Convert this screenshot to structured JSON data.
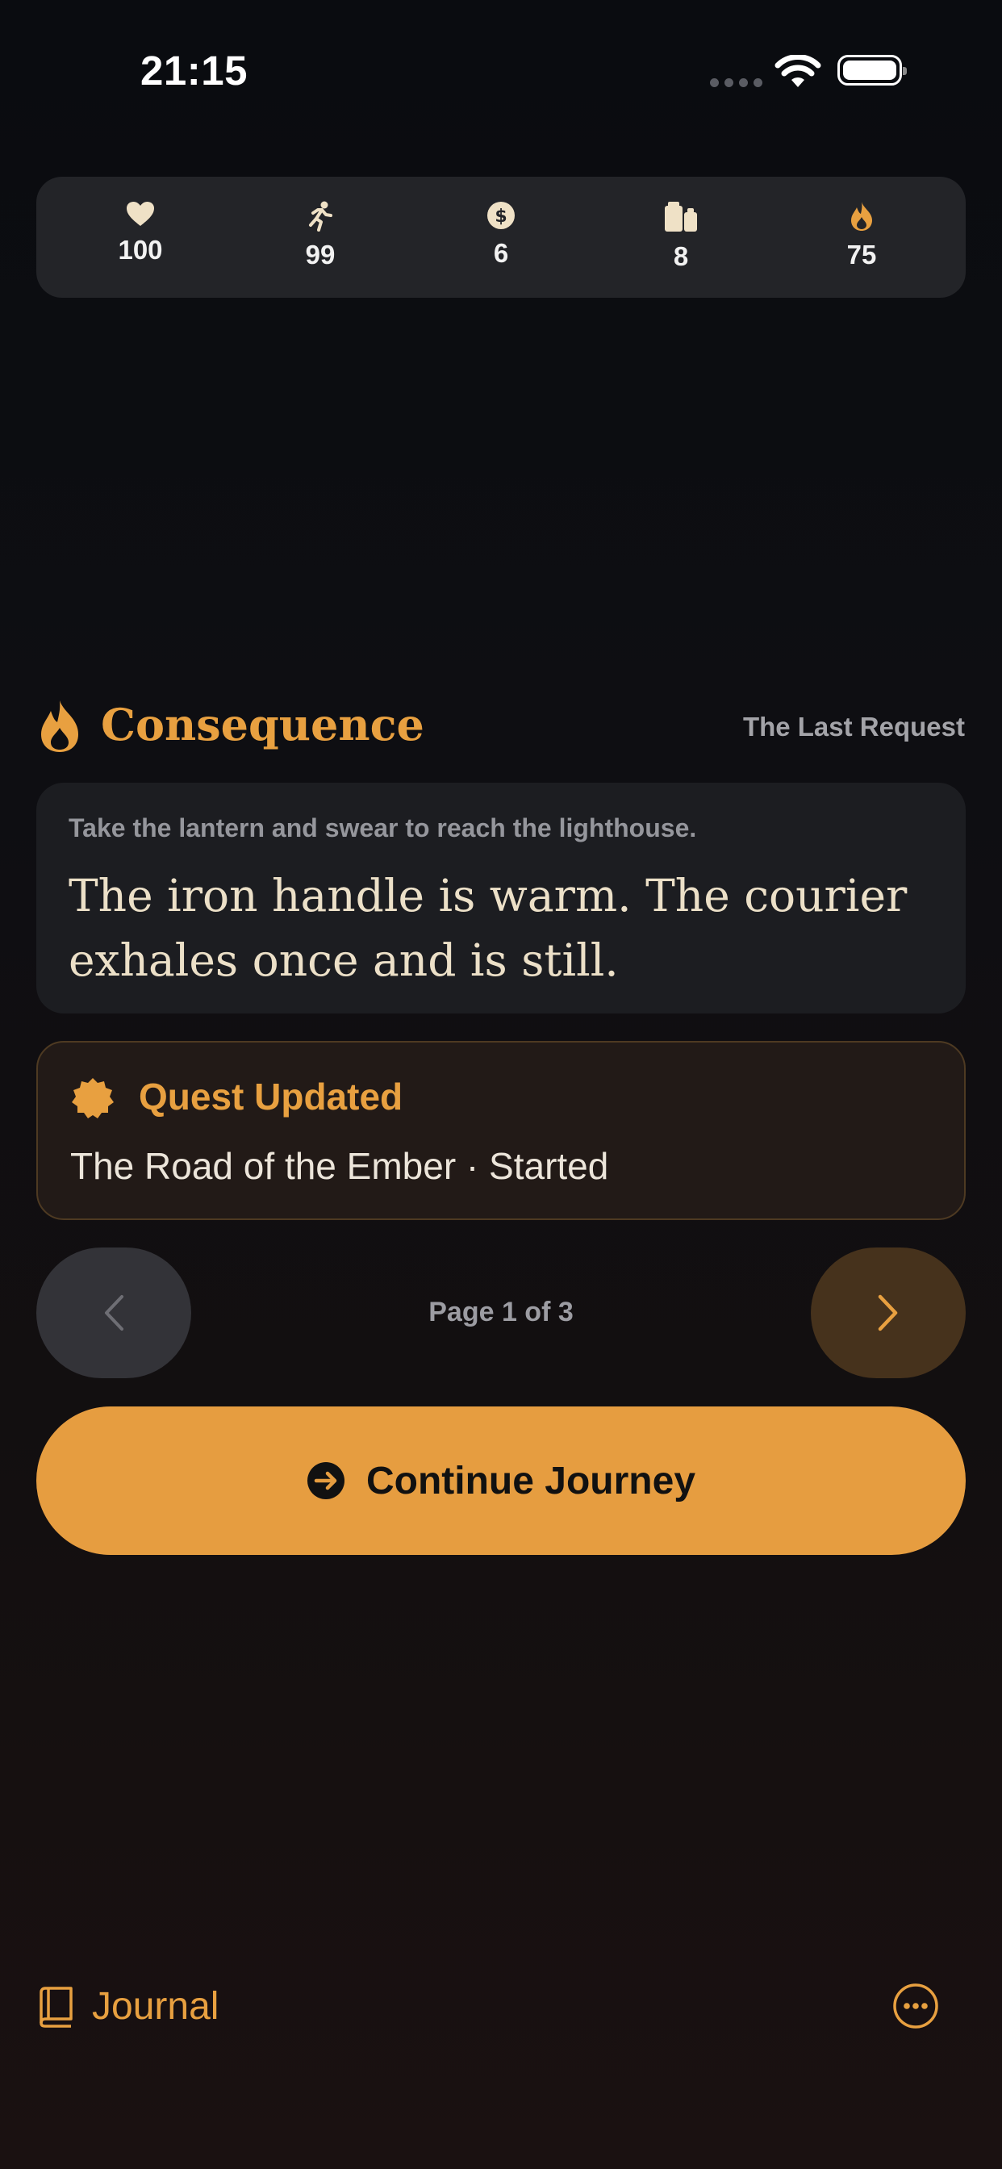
{
  "status_bar": {
    "time": "21:15"
  },
  "stats": [
    {
      "icon": "heart-icon",
      "value": "100"
    },
    {
      "icon": "running-figure-icon",
      "value": "99"
    },
    {
      "icon": "coin-icon",
      "value": "6"
    },
    {
      "icon": "supplies-icon",
      "value": "8"
    },
    {
      "icon": "flame-icon",
      "value": "75"
    }
  ],
  "consequence": {
    "title": "Consequence",
    "chapter": "The Last Request",
    "choice": "Take the lantern and swear to reach the lighthouse.",
    "text": "The iron handle is warm. The courier exhales once and is still."
  },
  "quest": {
    "title": "Quest Updated",
    "detail": "The Road of the Ember · Started"
  },
  "pagination": {
    "label": "Page 1 of 3",
    "current": 1,
    "total": 3
  },
  "continue_button": {
    "label": "Continue Journey"
  },
  "bottom_bar": {
    "journal_label": "Journal"
  },
  "colors": {
    "accent": "#e8a040",
    "button": "#e69d40",
    "card": "#1c1d21",
    "story_text": "#ece0c8"
  }
}
